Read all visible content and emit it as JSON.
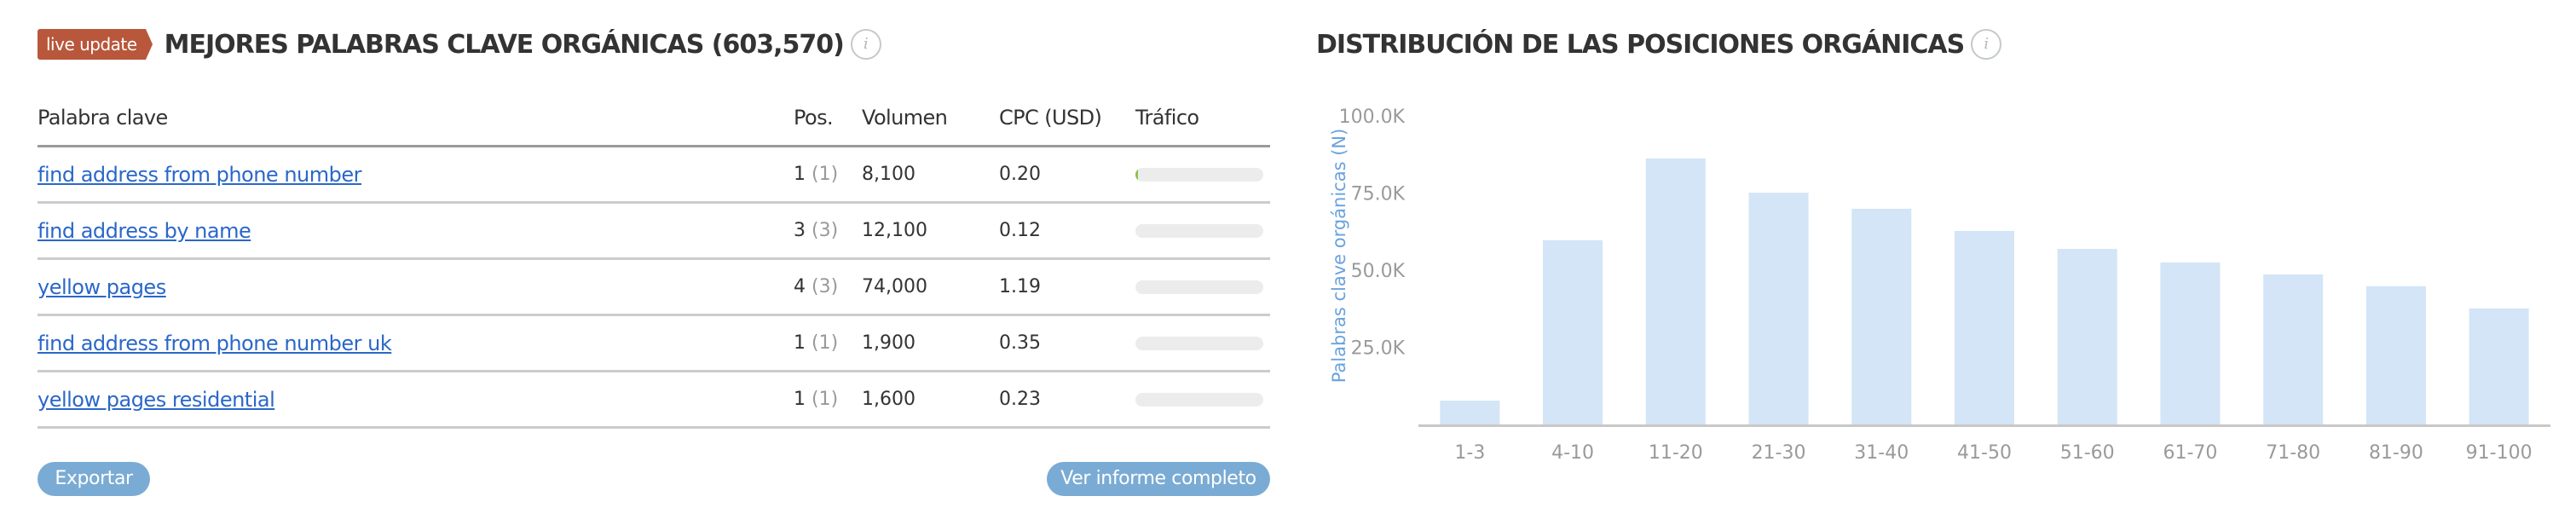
{
  "keywords_panel": {
    "badge": "live update",
    "title": "MEJORES PALABRAS CLAVE ORGÁNICAS (603,570)",
    "info_icon": "info-icon",
    "columns": [
      "Palabra clave",
      "Pos.",
      "Volumen",
      "CPC (USD)",
      "Tráfico"
    ],
    "rows": [
      {
        "keyword": "find address from phone number",
        "pos": "1",
        "prev_pos": "(1)",
        "volume": "8,100",
        "cpc": "0.20",
        "traffic_fraction": 0.02
      },
      {
        "keyword": "find address by name",
        "pos": "3",
        "prev_pos": "(3)",
        "volume": "12,100",
        "cpc": "0.12",
        "traffic_fraction": 0
      },
      {
        "keyword": "yellow pages",
        "pos": "4",
        "prev_pos": "(3)",
        "volume": "74,000",
        "cpc": "1.19",
        "traffic_fraction": 0
      },
      {
        "keyword": "find address from phone number uk",
        "pos": "1",
        "prev_pos": "(1)",
        "volume": "1,900",
        "cpc": "0.35",
        "traffic_fraction": 0
      },
      {
        "keyword": "yellow pages residential",
        "pos": "1",
        "prev_pos": "(1)",
        "volume": "1,600",
        "cpc": "0.23",
        "traffic_fraction": 0
      }
    ],
    "export_label": "Exportar",
    "full_report_label": "Ver informe completo"
  },
  "distribution_panel": {
    "title": "DISTRIBUCIÓN DE LAS POSICIONES ORGÁNICAS",
    "info_icon": "info-icon"
  },
  "colors": {
    "badge": "#b8573b",
    "link": "#2a67c9",
    "button": "#7aabd4",
    "bar": "#d3e5f6",
    "axis_label": "#6aa3dc",
    "traffic_fill": "#8bc34a"
  },
  "chart_data": {
    "type": "bar",
    "title": "DISTRIBUCIÓN DE LAS POSICIONES ORGÁNICAS",
    "xlabel": "",
    "ylabel": "Palabras clave orgánicas (N)",
    "categories": [
      "1-3",
      "4-10",
      "11-20",
      "21-30",
      "31-40",
      "41-50",
      "51-60",
      "61-70",
      "71-80",
      "81-90",
      "91-100"
    ],
    "values": [
      7700,
      59700,
      86200,
      75100,
      69900,
      62700,
      56900,
      52500,
      48600,
      44800,
      37600
    ],
    "ylim": [
      0,
      100000
    ],
    "yticks": [
      25000,
      50000,
      75000,
      100000
    ],
    "ytick_labels": [
      "25.0K",
      "50.0K",
      "75.0K",
      "100.0K"
    ],
    "grid": false,
    "legend": "none"
  }
}
